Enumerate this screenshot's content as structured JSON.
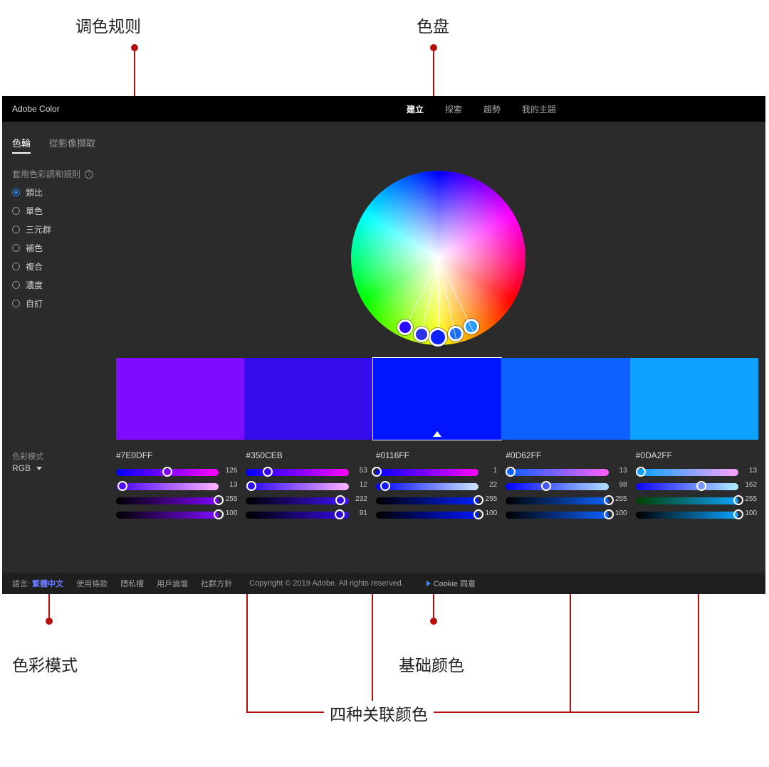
{
  "annotations": {
    "rules": "调色规则",
    "wheel": "色盘",
    "mode": "色彩模式",
    "base": "基础颜色",
    "related": "四种关联颜色"
  },
  "header": {
    "brand": "Adobe Color",
    "nav": [
      "建立",
      "探索",
      "趨勢",
      "我的主題"
    ],
    "nav_active": 0
  },
  "subtabs": {
    "items": [
      "色輪",
      "從影像擷取"
    ],
    "active": 0
  },
  "rules": {
    "title": "套用色彩調和規則",
    "items": [
      "類比",
      "單色",
      "三元群",
      "補色",
      "複合",
      "濃度",
      "自訂"
    ],
    "selected": 0
  },
  "wheel": {
    "markers": [
      {
        "angle": -26,
        "dist": 118,
        "color": "#2a9cff"
      },
      {
        "angle": -13,
        "dist": 120,
        "color": "#1c6ef5"
      },
      {
        "angle": 0,
        "dist": 122,
        "color": "#0e22ff",
        "base": true
      },
      {
        "angle": 12,
        "dist": 120,
        "color": "#2e30e6"
      },
      {
        "angle": 25,
        "dist": 118,
        "color": "#2b0bff"
      }
    ]
  },
  "swatches": [
    {
      "hex": "#7E0DFF",
      "base": false
    },
    {
      "hex": "#350CEB",
      "base": false
    },
    {
      "hex": "#0116FF",
      "base": true
    },
    {
      "hex": "#0D62FF",
      "base": false
    },
    {
      "hex": "#0DA2FF",
      "base": false
    }
  ],
  "colorMode": {
    "label": "色彩模式",
    "value": "RGB"
  },
  "sliders": [
    {
      "hex": "#7E0DFF",
      "rows": [
        {
          "v": 126,
          "pct": 50,
          "grad": "linear-gradient(90deg,#0000ff,#ff00ff)"
        },
        {
          "v": 13,
          "pct": 6,
          "grad": "linear-gradient(90deg,#4400ff,#ffb3ff)"
        },
        {
          "v": 255,
          "pct": 100,
          "grad": "linear-gradient(90deg,#000000,#8000ff)"
        },
        {
          "v": 100,
          "pct": 100,
          "grad": "linear-gradient(90deg,#000000,#7e0dff)"
        }
      ]
    },
    {
      "hex": "#350CEB",
      "rows": [
        {
          "v": 53,
          "pct": 21,
          "grad": "linear-gradient(90deg,#0000ff,#ff00ff)"
        },
        {
          "v": 12,
          "pct": 5,
          "grad": "linear-gradient(90deg,#2200ff,#ffb3ff)"
        },
        {
          "v": 232,
          "pct": 92,
          "grad": "linear-gradient(90deg,#000000,#4010ff)"
        },
        {
          "v": 91,
          "pct": 91,
          "grad": "linear-gradient(90deg,#000000,#350ceb)"
        }
      ]
    },
    {
      "hex": "#0116FF",
      "rows": [
        {
          "v": 1,
          "pct": 1,
          "grad": "linear-gradient(90deg,#0000ff,#ff00ff)"
        },
        {
          "v": 22,
          "pct": 9,
          "grad": "linear-gradient(90deg,#0000ff,#cce6ff)"
        },
        {
          "v": 255,
          "pct": 100,
          "grad": "linear-gradient(90deg,#000000,#0120ff)"
        },
        {
          "v": 100,
          "pct": 100,
          "grad": "linear-gradient(90deg,#000000,#0116ff)"
        }
      ]
    },
    {
      "hex": "#0D62FF",
      "rows": [
        {
          "v": 13,
          "pct": 5,
          "grad": "linear-gradient(90deg,#0060ff,#ff60ff)"
        },
        {
          "v": 98,
          "pct": 39,
          "grad": "linear-gradient(90deg,#0000ff,#b3e0ff)"
        },
        {
          "v": 255,
          "pct": 100,
          "grad": "linear-gradient(90deg,#000000,#0d62ff)"
        },
        {
          "v": 100,
          "pct": 100,
          "grad": "linear-gradient(90deg,#000000,#0d62ff)"
        }
      ]
    },
    {
      "hex": "#0DA2FF",
      "rows": [
        {
          "v": 13,
          "pct": 5,
          "grad": "linear-gradient(90deg,#00a2ff,#ffa2ff)"
        },
        {
          "v": 162,
          "pct": 64,
          "grad": "linear-gradient(90deg,#0d00ff,#b3f0ff)"
        },
        {
          "v": 255,
          "pct": 100,
          "grad": "linear-gradient(90deg,#004000,#0da2ff)"
        },
        {
          "v": 100,
          "pct": 100,
          "grad": "linear-gradient(90deg,#000000,#0da2ff)"
        }
      ]
    }
  ],
  "footer": {
    "lang_label": "語言:",
    "lang_value": "繁體中文",
    "links": [
      "使用條款",
      "隱私權",
      "用戶論壇",
      "社群方針"
    ],
    "copyright": "Copyright © 2019 Adobe. All rights reserved.",
    "cookie": "Cookie 同意"
  }
}
